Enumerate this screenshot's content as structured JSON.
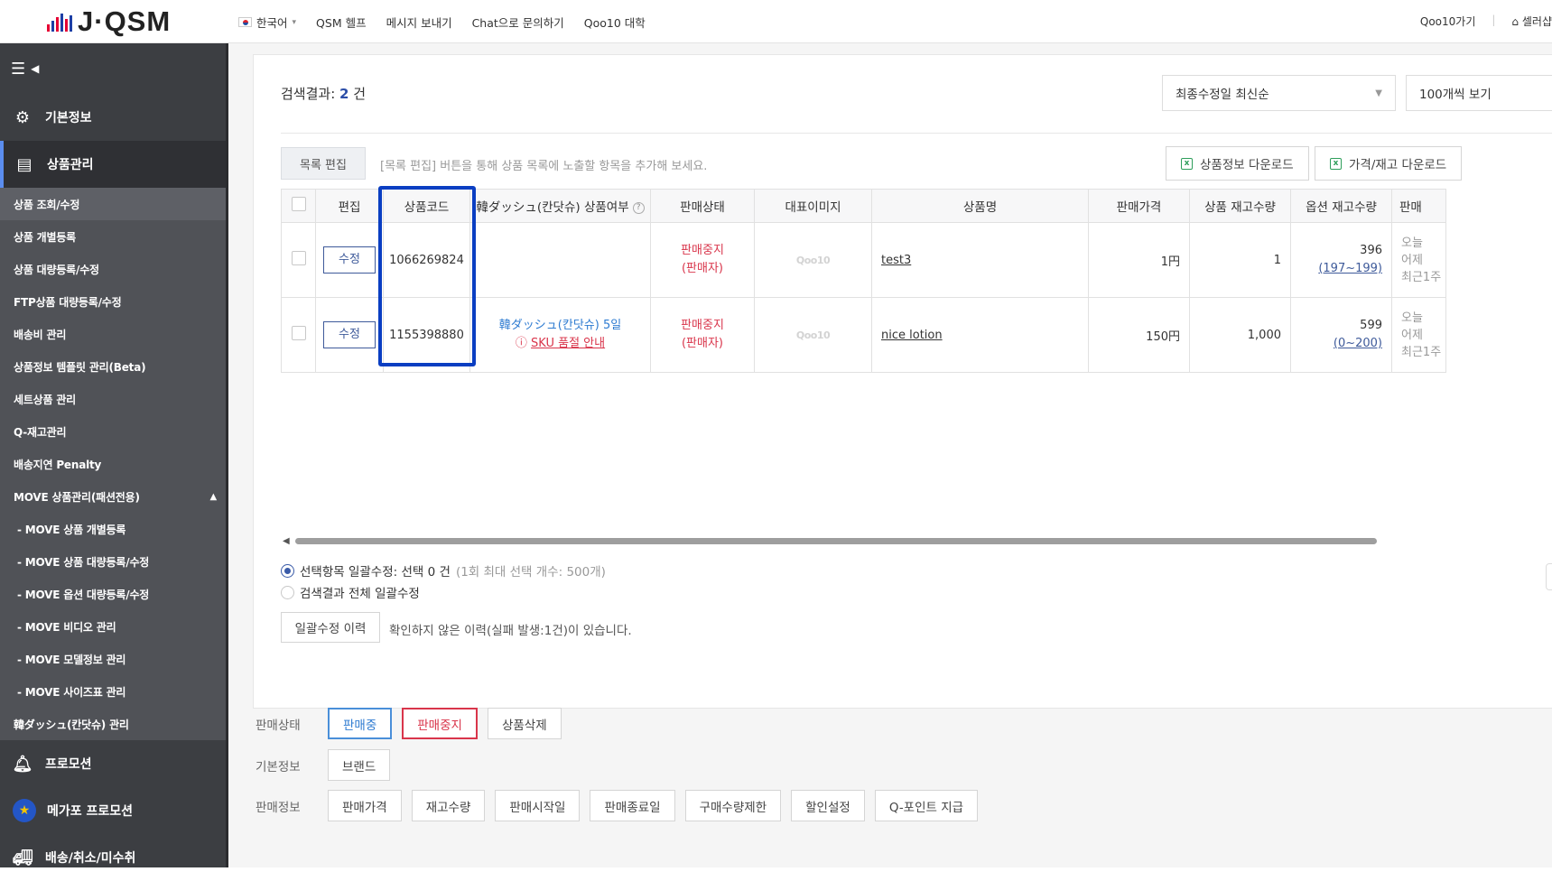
{
  "topbar": {
    "logo_text": "J·QSM",
    "lang": "한국어",
    "nav": [
      "QSM 헬프",
      "메시지 보내기",
      "Chat으로 문의하기",
      "Qoo10 대학"
    ],
    "right_links": [
      "Qoo10가기",
      "셀러샵"
    ]
  },
  "sidebar": {
    "sections": {
      "basic": "기본정보",
      "product": "상품관리",
      "promotion": "프로모션",
      "mega": "메가포 프로모션",
      "shipping": "배송/취소/미수취"
    },
    "sub_items": [
      "상품 조회/수정",
      "상품 개별등록",
      "상품 대량등록/수정",
      "FTP상품 대량등록/수정",
      "배송비 관리",
      "상품정보 템플릿 관리(Beta)",
      "세트상품 관리",
      "Q-재고관리",
      "배송지연 Penalty",
      "MOVE 상품관리(패션전용)",
      "- MOVE 상품 개별등록",
      "- MOVE 상품 대량등록/수정",
      "- MOVE 옵션 대량등록/수정",
      "- MOVE 비디오 관리",
      "- MOVE 모델정보 관리",
      "- MOVE 사이즈표 관리",
      "韓ダッシュ(칸닷슈) 관리"
    ]
  },
  "results": {
    "label": "검색결과:",
    "count": "2",
    "unit": "건"
  },
  "sort_select": "최종수정일 최신순",
  "page_size_select": "100개씩 보기",
  "edit_list_button": "목록 편집",
  "edit_list_hint": "[목록 편집] 버튼을 통해 상품 목록에 노출할 항목을 추가해 보세요.",
  "download_buttons": [
    "상품정보 다운로드",
    "가격/재고 다운로드"
  ],
  "table": {
    "headers": [
      "편집",
      "상품코드",
      "韓ダッシュ(칸닷슈) 상품여부",
      "판매상태",
      "대표이미지",
      "상품명",
      "판매가격",
      "상품 재고수량",
      "옵션 재고수량",
      "판매"
    ],
    "rows": [
      {
        "edit_label": "수정",
        "code": "1066269824",
        "dash": "",
        "dash_sku": "",
        "status": "판매중지",
        "status_sub": "(판매자)",
        "image_placeholder": "Qoo10",
        "name": "test3",
        "price": "1円",
        "stock": "1",
        "option_stock": "396",
        "option_range": "(197~199)",
        "period": [
          "오늘",
          "어제",
          "최근1주"
        ]
      },
      {
        "edit_label": "수정",
        "code": "1155398880",
        "dash": "韓ダッシュ(칸닷슈) 5일",
        "dash_sku": "SKU 품절 안내",
        "status": "판매중지",
        "status_sub": "(판매자)",
        "image_placeholder": "Qoo10",
        "name": "nice lotion",
        "price": "150円",
        "stock": "1,000",
        "option_stock": "599",
        "option_range": "(0~200)",
        "period": [
          "오늘",
          "어제",
          "최근1주"
        ]
      }
    ]
  },
  "bulk": {
    "selected_label": "선택항목 일괄수정: 선택 0 건",
    "selected_note": "(1회 최대 선택 개수: 500개)",
    "all_label": "검색결과 전체 일괄수정",
    "history_button": "일괄수정 이력",
    "history_msg": "확인하지 않은 이력(실패 발생:1건)이 있습니다."
  },
  "filters": {
    "status_label": "판매상태",
    "status_buttons": [
      "판매중",
      "판매중지",
      "상품삭제"
    ],
    "basic_label": "기본정보",
    "basic_buttons": [
      "브랜드"
    ],
    "sales_label": "판매정보",
    "sales_buttons": [
      "판매가격",
      "재고수량",
      "판매시작일",
      "판매종료일",
      "구매수량제한",
      "할인설정",
      "Q-포인트 지급"
    ]
  },
  "colors": {
    "accent_blue": "#2c4ea8",
    "highlight_box": "#0a3ec2",
    "sidebar_bg": "#3c3e42",
    "status_red": "#d9354b"
  }
}
